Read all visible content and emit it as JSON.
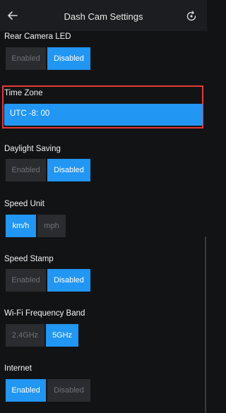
{
  "header": {
    "title": "Dash Cam Settings",
    "back_icon": "arrow-left-icon",
    "refresh_icon": "refresh-icon"
  },
  "rear_camera_led": {
    "label": "Rear Camera LED",
    "options": [
      "Enabled",
      "Disabled"
    ],
    "selected": "Disabled"
  },
  "time_zone": {
    "label": "Time Zone",
    "value": "UTC -8: 00"
  },
  "daylight_saving": {
    "label": "Daylight Saving",
    "options": [
      "Enabled",
      "Disabled"
    ],
    "selected": "Disabled"
  },
  "speed_unit": {
    "label": "Speed Unit",
    "options": [
      "km/h",
      "mph"
    ],
    "selected": "km/h"
  },
  "speed_stamp": {
    "label": "Speed Stamp",
    "options": [
      "Enabled",
      "Disabled"
    ],
    "selected": "Disabled"
  },
  "wifi_band": {
    "label": "Wi-Fi Frequency Band",
    "options": [
      "2.4GHz",
      "5GHz"
    ],
    "selected": "5GHz"
  },
  "internet": {
    "label": "Internet",
    "options": [
      "Enabled",
      "Disabled"
    ],
    "selected": "Enabled"
  },
  "colors": {
    "accent": "#2196f3",
    "highlight_border": "#e53935",
    "background": "#121315"
  }
}
